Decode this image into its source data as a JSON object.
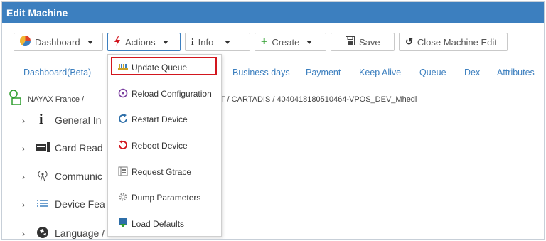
{
  "window": {
    "title": "Edit Machine"
  },
  "toolbar": {
    "dashboard_label": "Dashboard",
    "actions_label": "Actions",
    "info_label": "Info",
    "create_label": "Create",
    "save_label": "Save",
    "close_edit_label": "Close Machine Edit"
  },
  "tabs": [
    "Dashboard(Beta)",
    "Business days",
    "Payment",
    "Keep Alive",
    "Queue",
    "Dex",
    "Attributes"
  ],
  "breadcrumb": {
    "left": "NAYAX France /",
    "right": "T / CARTADIS / 4040418180510464-VPOS_DEV_Mhedi"
  },
  "sections": [
    "General In",
    "Card Read",
    "Communic",
    "Device Fea",
    "Language / Audio"
  ],
  "actions_menu": {
    "items": [
      {
        "label": "Update Queue",
        "icon": "queue-icon"
      },
      {
        "label": "Reload Configuration",
        "icon": "reload-icon"
      },
      {
        "label": "Restart Device",
        "icon": "restart-icon"
      },
      {
        "label": "Reboot Device",
        "icon": "reboot-icon"
      },
      {
        "label": "Request Gtrace",
        "icon": "gtrace-icon"
      },
      {
        "label": "Dump Parameters",
        "icon": "gear-icon"
      },
      {
        "label": "Load Defaults",
        "icon": "download-icon"
      }
    ],
    "highlighted_index": 0
  },
  "colors": {
    "titlebar": "#3c7fbf",
    "link": "#3c7fbf",
    "highlight_border": "#d2161e",
    "create_plus": "#2e9e2e",
    "actions_bolt": "#d2161e"
  }
}
